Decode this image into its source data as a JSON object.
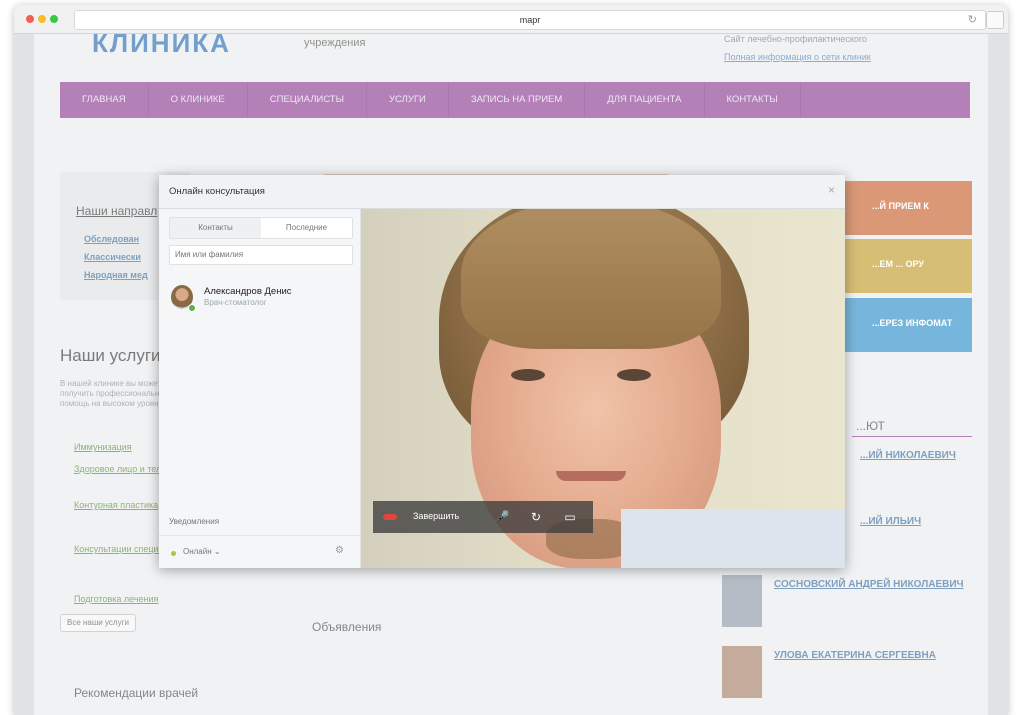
{
  "browser": {
    "url": "mapr"
  },
  "site": {
    "logo": "КЛИНИКА",
    "logo_sub": "учреждения",
    "header_lines": [
      "Сайт лечебно-профилактического",
      "Полная информация о сети клиник"
    ],
    "nav": [
      "ГЛАВНАЯ",
      "О КЛИНИКЕ",
      "СПЕЦИАЛИСТЫ",
      "УСЛУГИ",
      "ЗАПИСЬ НА ПРИЕМ",
      "ДЛЯ ПАЦИЕНТА",
      "КОНТАКТЫ"
    ],
    "directions_title": "Наши направл",
    "directions": [
      "Обследован",
      "Классически",
      "Народная мед"
    ],
    "services_title": "Наши услуги",
    "services_text": "В нашей клинике вы можете получить профессиональную помощь на высоком уровне.",
    "services": [
      "Иммунизация",
      "Здоровое лицо и тело",
      "Контурная пластика",
      "Консультации специалистов",
      "Подготовка лечения"
    ],
    "all_services": "Все наши услуги",
    "recommend": "Рекомендации врачей",
    "announcements": "Объявления",
    "side_buttons": [
      "...Й ПРИЕМ К",
      "...ЕМ ... ОРУ",
      "...ЕРЕЗ ИНФОМАТ"
    ],
    "side_section": "...ЮТ",
    "doctors": [
      "...ИЙ НИКОЛАЕВИЧ",
      "...ИЙ ИЛЬИЧ",
      "СОСНОВСКИЙ АНДРЕЙ НИКОЛАЕВИЧ",
      "УЛОВА ЕКАТЕРИНА СЕРГЕЕВНА"
    ]
  },
  "dialog": {
    "title": "Онлайн консультация",
    "close": "×",
    "tabs": [
      "Контакты",
      "Последние"
    ],
    "search_placeholder": "Имя или фамилия",
    "contact": {
      "name": "Александров Денис",
      "role": "Врач-стоматолог"
    },
    "notifications": "Уведомления",
    "status": "Онлайн",
    "status_caret": "⌄",
    "gear": "⚙"
  },
  "controls": {
    "hangup_label": "Завершить",
    "mic_icon": "🎤",
    "flip_icon": "↻",
    "screen_icon": "▭"
  },
  "colors": {
    "nav": "#8a3d92",
    "hangup": "#e0463b",
    "online": "#5ab043"
  }
}
